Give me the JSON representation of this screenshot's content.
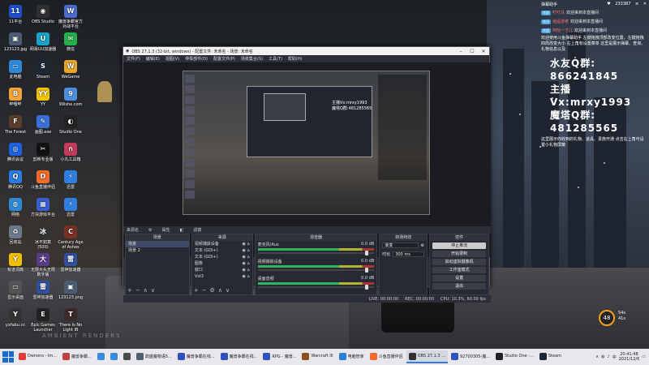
{
  "desktop_icons": [
    {
      "label": "11平台",
      "color": "#1f4fd1",
      "glyph": "11"
    },
    {
      "label": "OBS Studio",
      "color": "#303030",
      "glyph": "◉"
    },
    {
      "label": "魔兽争霸官方对战平台",
      "color": "#4a6cd0",
      "glyph": "W"
    },
    {
      "label": "123123.jpg",
      "color": "#4b5d72",
      "glyph": "▣"
    },
    {
      "label": "网易UU加速器",
      "color": "#1aa3c8",
      "glyph": "U"
    },
    {
      "label": "微信",
      "color": "#22b04a",
      "glyph": "✉"
    },
    {
      "label": "此电脑",
      "color": "#2d89d8",
      "glyph": "▭"
    },
    {
      "label": "Steam",
      "color": "#1b2838",
      "glyph": "S"
    },
    {
      "label": "WeGame",
      "color": "#e8a62a",
      "glyph": "W"
    },
    {
      "label": "哔哩哔",
      "color": "#f2a33a",
      "glyph": "B"
    },
    {
      "label": "YY",
      "color": "#f5c400",
      "glyph": "YY"
    },
    {
      "label": "99ishe.com",
      "color": "#4c8fe0",
      "glyph": "9"
    },
    {
      "label": "The Forest",
      "color": "#5b3d2a",
      "glyph": "F"
    },
    {
      "label": "画图.exe",
      "color": "#3a6fd8",
      "glyph": "✎"
    },
    {
      "label": "Studio One",
      "color": "#222",
      "glyph": "◐"
    },
    {
      "label": "腾讯会议",
      "color": "#1e62e0",
      "glyph": "◎"
    },
    {
      "label": "剪映专业版",
      "color": "#111",
      "glyph": "✂"
    },
    {
      "label": "小丸工具箱",
      "color": "#c43a5a",
      "glyph": "∩"
    },
    {
      "label": "腾讯QQ",
      "color": "#2a7de0",
      "glyph": "Q"
    },
    {
      "label": "斗鱼直播伴侣",
      "color": "#f36a2a",
      "glyph": "D"
    },
    {
      "label": "迅雷",
      "color": "#2f7fe0",
      "glyph": "⚡"
    },
    {
      "label": "网络",
      "color": "#2d89d8",
      "glyph": "◍"
    },
    {
      "label": "方块游戏平台",
      "color": "#3a5fd0",
      "glyph": "▦"
    },
    {
      "label": "迅雷",
      "color": "#2f7fe0",
      "glyph": "⚡"
    },
    {
      "label": "回收站",
      "color": "#6b7b8c",
      "glyph": "♻"
    },
    {
      "label": "冰不如意 (500)",
      "color": "#333",
      "glyph": "冰"
    },
    {
      "label": "Century Age of Ashes",
      "color": "#7a3020",
      "glyph": "C"
    },
    {
      "label": "有道词典",
      "color": "#f0c000",
      "glyph": "Y"
    },
    {
      "label": "无限大头无限数字版",
      "color": "#5a3b8a",
      "glyph": "大"
    },
    {
      "label": "雷神加速器",
      "color": "#3050a0",
      "glyph": "雷"
    },
    {
      "label": "显示桌面",
      "color": "#555",
      "glyph": "▭"
    },
    {
      "label": "雷神加速器",
      "color": "#3050a0",
      "glyph": "雷"
    },
    {
      "label": "123123.png",
      "color": "#4b5d72",
      "glyph": "▣"
    },
    {
      "label": "yxfabu.cc",
      "color": "#333",
      "glyph": "Y"
    },
    {
      "label": "Epic Games Launcher",
      "color": "#222",
      "glyph": "E"
    },
    {
      "label": "There Is No Light IB",
      "color": "#3c2a2a",
      "glyph": "T"
    }
  ],
  "obs": {
    "title": "OBS 27.1.3 (32-bit, windows) - 配置文件: 未命名 - 场景: 未命名",
    "menus": [
      "文件(F)",
      "编辑(E)",
      "视图(V)",
      "停靠部件(D)",
      "配置文件(P)",
      "场景集合(S)",
      "工具(T)",
      "帮助(H)"
    ],
    "preview_lines": [
      "主播Vx:mrxy1993",
      "魔塔Q群:481285565"
    ],
    "info_label": "来源名",
    "info_props": "属性",
    "info_filters": "滤镜",
    "docks": {
      "scenes": {
        "title": "场景",
        "items": [
          "场景",
          "场景 2"
        ]
      },
      "sources": {
        "title": "来源",
        "items": [
          "视频捕获设备",
          "文本 (GDI+)",
          "文本 (GDI+)",
          "图像",
          "窗口",
          "Vst3"
        ]
      },
      "mixer": {
        "title": "混音器",
        "channels": [
          {
            "name": "麦克风/Aux",
            "db": "0.0 dB"
          },
          {
            "name": "视频捕获设备",
            "db": "0.0 dB"
          },
          {
            "name": "桌面音频",
            "db": "0.0 dB"
          }
        ]
      },
      "transitions": {
        "title": "转场特效",
        "value": "渐变",
        "duration_label": "时长",
        "duration": "300 ms"
      },
      "controls": {
        "title": "控件",
        "buttons": [
          "停止推流",
          "开始录制",
          "启动虚拟摄像机",
          "工作室模式",
          "设置",
          "退出"
        ]
      }
    },
    "status": {
      "live": "LIVE: 00:00:00",
      "rec": "REC: 00:00:00",
      "cpu": "CPU: 10.3%, 60.00 fps"
    }
  },
  "chat": {
    "header": "弹幕助手",
    "followers": "233387",
    "messages": [
      {
        "badge": "欢迎",
        "nick": "叮叮马",
        "text": "欢迎来到本直播间"
      },
      {
        "badge": "欢迎",
        "nick": "逍遥游者",
        "text": "欢迎来到本直播间"
      },
      {
        "badge": "欢迎",
        "nick": "阿哒一下儿",
        "text": "欢迎来到本直播间"
      }
    ],
    "note": "欢迎使用斗鱼弹幕助手 左键拖拽顶部改变位置，左键拖拽四周改变大小 右上角有设置菜单 这里是展示弹幕、查询、礼物信息以及",
    "big_lines": [
      "水友Q群: 866241845",
      "主播Vx:mrxy1993",
      "魔塔Q群: 481285565"
    ],
    "note2": "这里展示你收到的礼物、道具、贵族开通 点击右上角可设置小礼物屏蔽"
  },
  "widget": {
    "value": "48",
    "line1": "54s",
    "line2": "41s"
  },
  "watermark": "AMBIENT RENDERS",
  "taskbar": {
    "items": [
      {
        "label": "Dwnons - Im...",
        "color": "#e03a3a"
      },
      {
        "label": "魔兽争霸...",
        "color": "#c04040"
      },
      {
        "label": "",
        "color": "#3a8ae0"
      },
      {
        "label": "",
        "color": "#3a8ae0"
      },
      {
        "label": "",
        "color": "#4a4a4a"
      },
      {
        "label": "鼎盛魔物语5...",
        "color": "#506070"
      },
      {
        "label": "魔兽争霸在线...",
        "color": "#3050c0"
      },
      {
        "label": "魔兽争霸在线...",
        "color": "#3050c0"
      },
      {
        "label": "RPG - 魔兽...",
        "color": "#3050c0"
      },
      {
        "label": "Warcraft III",
        "color": "#8a5020"
      },
      {
        "label": "电脑管家",
        "color": "#2a80d8"
      },
      {
        "label": "斗鱼直播伴侣",
        "color": "#f36a2a"
      },
      {
        "label": "OBS 27.1.3 ...",
        "color": "#303030",
        "active": true
      },
      {
        "label": "92700305-魔...",
        "color": "#3050c0"
      },
      {
        "label": "Studio One -...",
        "color": "#222"
      },
      {
        "label": "Steam",
        "color": "#1b2838"
      }
    ],
    "time": "20:41:48",
    "date": "2021/12/6"
  }
}
